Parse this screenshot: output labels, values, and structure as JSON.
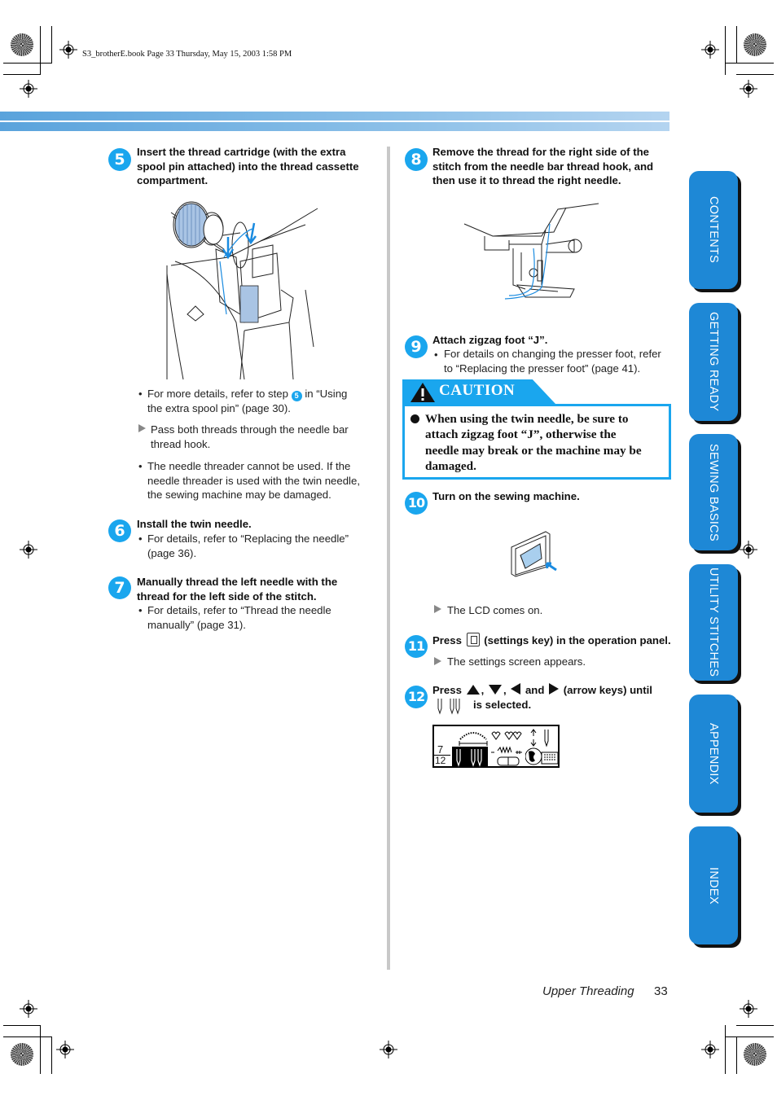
{
  "header": {
    "file_info": "S3_brotherE.book  Page 33  Thursday, May 15, 2003  1:58 PM"
  },
  "left_column": {
    "step5": {
      "number": "5",
      "title_lines": [
        "Insert the thread cartridge (with the extra",
        "spool pin attached) into the thread cassette",
        "compartment."
      ],
      "illustration": "thread-cartridge-insertion-illustration",
      "note1_lines": [
        "For more details, refer to step",
        "in “Using",
        "the extra spool pin” (page 30)."
      ],
      "note1_ref_step": "5",
      "result_lines": [
        "Pass both threads through the needle bar",
        "thread hook."
      ],
      "note2_lines": [
        "The needle threader cannot be used. If the",
        "needle threader is used with the twin needle,",
        "the sewing machine may be damaged."
      ]
    },
    "step6": {
      "number": "6",
      "title": "Install the twin needle.",
      "note_lines": [
        "For details, refer to “Replacing the needle”",
        "(page 36)."
      ]
    },
    "step7": {
      "number": "7",
      "title_lines": [
        "Manually thread the left needle with the",
        "thread for the left side of the stitch."
      ],
      "note_lines": [
        "For details, refer to “Thread the needle",
        "manually” (page 31)."
      ]
    }
  },
  "right_column": {
    "step8": {
      "number": "8",
      "title_lines": [
        "Remove the thread for the right side of the",
        "stitch from the needle bar thread hook, and",
        "then use it to thread the right needle."
      ],
      "illustration": "twin-needle-threading-illustration"
    },
    "step9": {
      "number": "9",
      "title": "Attach zigzag foot “J”.",
      "note_lines": [
        "For details on changing the presser foot, refer",
        "to “Replacing the presser foot” (page 41)."
      ]
    },
    "caution": {
      "label": "CAUTION",
      "text_lines": [
        "When using the twin needle, be sure to",
        "attach zigzag foot “J”, otherwise the",
        "needle may break or the machine may be",
        "damaged."
      ]
    },
    "step10": {
      "number": "10",
      "title": "Turn on the sewing machine.",
      "illustration": "power-switch-illustration",
      "result": "The LCD comes on."
    },
    "step11": {
      "number": "11",
      "title_press": "Press",
      "title_rest": "(settings key) in the operation panel.",
      "result": "The settings screen appears."
    },
    "step12": {
      "number": "12",
      "title_press": "Press",
      "sep1": ",",
      "sep2": ",",
      "and": "and",
      "title_rest": "(arrow keys) until",
      "line2": "is selected.",
      "lcd": {
        "page_current": "7",
        "page_total": "12"
      }
    }
  },
  "side_tabs": [
    {
      "label": "CONTENTS"
    },
    {
      "label": "GETTING READY"
    },
    {
      "label": "SEWING BASICS"
    },
    {
      "label": "UTILITY STITCHES"
    },
    {
      "label": "APPENDIX"
    },
    {
      "label": "INDEX"
    }
  ],
  "footer": {
    "section_title": "Upper Threading",
    "page_number": "33"
  },
  "colors": {
    "accent": "#1aa6ee",
    "tab_blue": "#1e88d6",
    "band_start": "#5aa3dc",
    "band_end": "#b4d4f0"
  }
}
